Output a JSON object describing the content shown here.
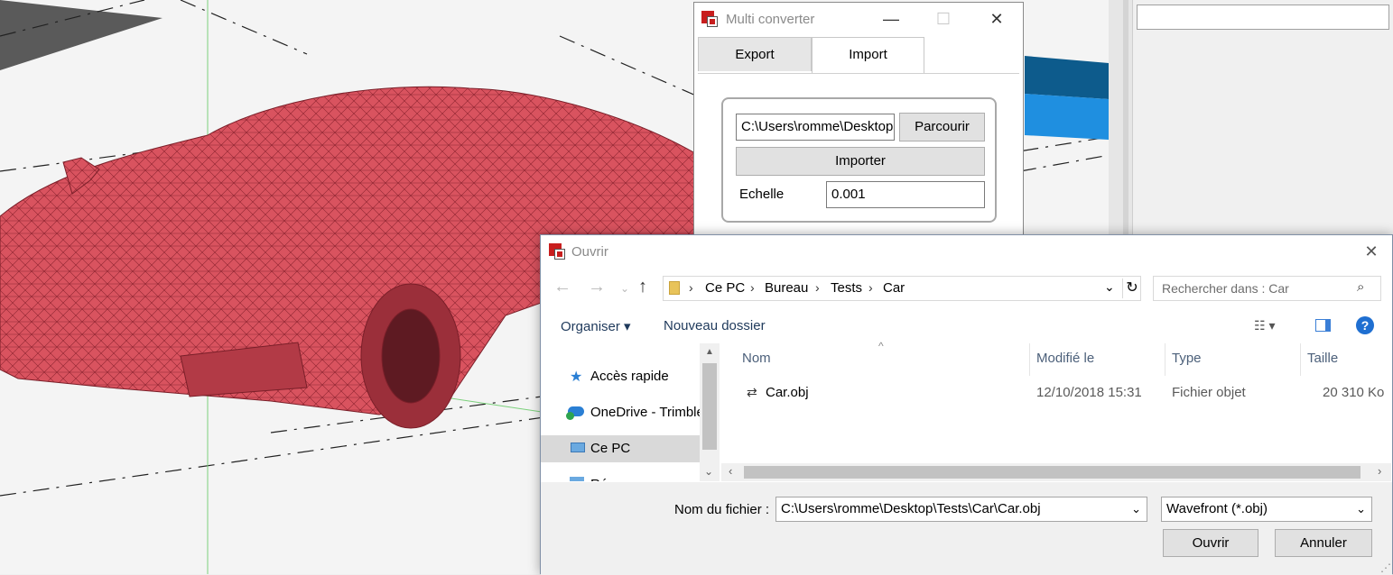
{
  "multi_converter": {
    "title": "Multi converter",
    "minimize_glyph": "—",
    "maximize_glyph": "☐",
    "close_glyph": "✕",
    "tabs": [
      {
        "label": "Export"
      },
      {
        "label": "Import"
      }
    ],
    "path_value": "C:\\Users\\romme\\Desktop",
    "browse_label": "Parcourir",
    "import_label": "Importer",
    "scale_label": "Echelle",
    "scale_value": "0.001"
  },
  "open_dialog": {
    "title": "Ouvrir",
    "close_glyph": "✕",
    "breadcrumb": [
      "Ce PC",
      "Bureau",
      "Tests",
      "Car"
    ],
    "search_placeholder": "Rechercher dans : Car",
    "organize_label": "Organiser ▾",
    "new_folder_label": "Nouveau dossier",
    "help_glyph": "?",
    "nav_items": [
      {
        "label": "Accès rapide",
        "icon": "star-icon"
      },
      {
        "label": "OneDrive - Trimble",
        "icon": "onedrive-icon"
      },
      {
        "label": "Ce PC",
        "icon": "computer-icon",
        "selected": true
      },
      {
        "label": "Ré",
        "icon": "network-icon"
      }
    ],
    "columns": [
      "Nom",
      "Modifié le",
      "Type",
      "Taille"
    ],
    "files": [
      {
        "name": "Car.obj",
        "modified": "12/10/2018 15:31",
        "type": "Fichier objet",
        "size": "20 310 Ko"
      }
    ],
    "filename_label": "Nom du fichier :",
    "filename_value": "C:\\Users\\romme\\Desktop\\Tests\\Car\\Car.obj",
    "filetype_value": "Wavefront (*.obj)",
    "open_label": "Ouvrir",
    "cancel_label": "Annuler"
  },
  "colors": {
    "car": "#d9535f",
    "mesh": "#8e2430",
    "accent_blue": "#0078d7"
  }
}
